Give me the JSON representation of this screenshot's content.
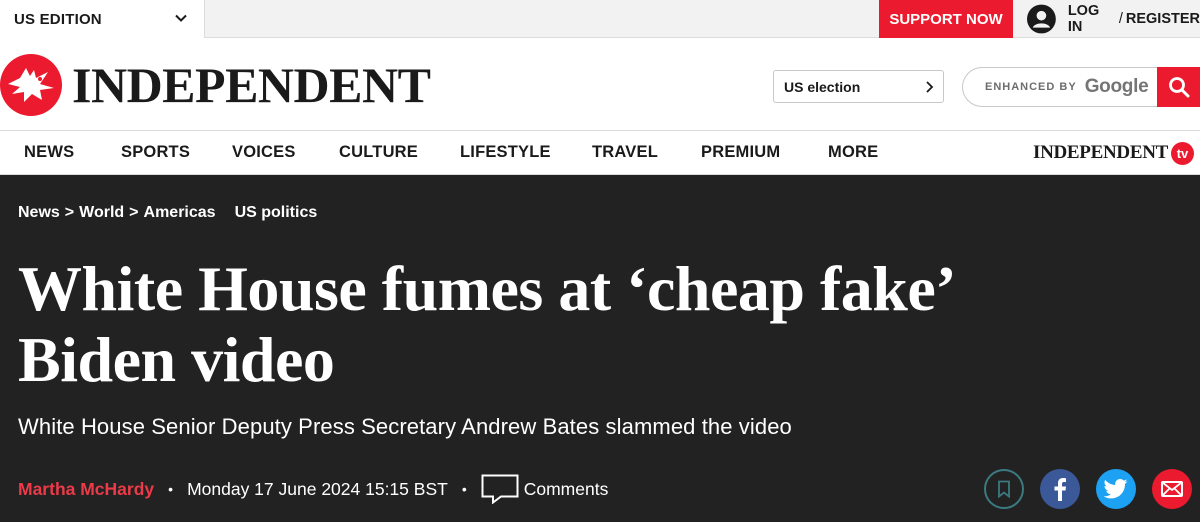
{
  "topbar": {
    "edition_label": "US EDITION",
    "support_label": "SUPPORT NOW",
    "login_label": "LOG IN",
    "login_sep": "/",
    "register_label": "REGISTER"
  },
  "masthead": {
    "logo_text": "INDEPENDENT",
    "us_election_label": "US election",
    "search_enhanced": "ENHANCED BY",
    "search_google": "Google"
  },
  "nav": {
    "items": [
      "NEWS",
      "SPORTS",
      "VOICES",
      "CULTURE",
      "LIFESTYLE",
      "TRAVEL",
      "PREMIUM",
      "MORE"
    ],
    "tv_word": "INDEPENDENT",
    "tv_badge": "tv"
  },
  "article": {
    "breadcrumb": [
      "News",
      "World",
      "Americas"
    ],
    "breadcrumb_sep": ">",
    "topic_tag": "US politics",
    "headline_line1": "White House fumes at ‘cheap fake’",
    "headline_line2": "Biden video",
    "standfirst": "White House Senior Deputy Press Secretary Andrew Bates slammed the video",
    "author": "Martha McHardy",
    "byline_sep": "•",
    "date": "Monday 17 June 2024 15:15 BST",
    "comments_label": "Comments"
  },
  "colors": {
    "brand_red": "#ec1a2e",
    "hero_bg": "#222222",
    "facebook": "#3b5998",
    "twitter": "#1da1f2"
  },
  "icons": [
    "chevron-down-icon",
    "user-avatar-icon",
    "eagle-logo-icon",
    "chevron-right-icon",
    "search-icon",
    "comment-bubble-icon",
    "bookmark-icon",
    "facebook-icon",
    "twitter-icon",
    "email-icon"
  ]
}
